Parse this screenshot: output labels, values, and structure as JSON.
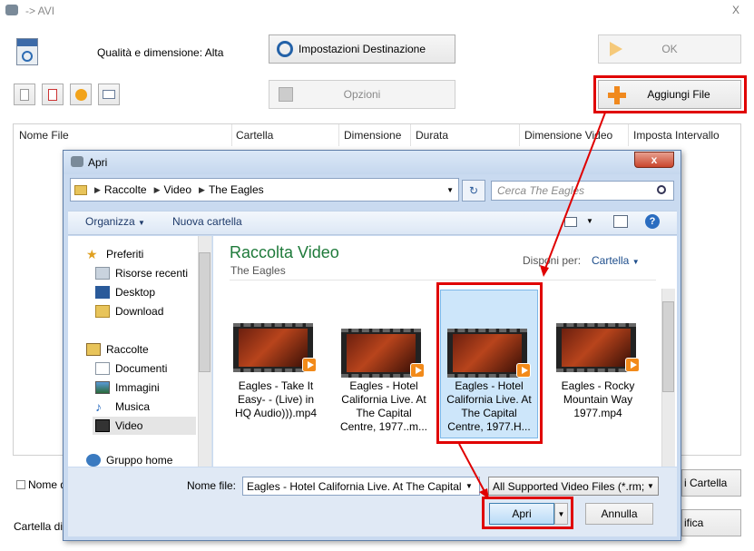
{
  "window": {
    "title": "-> AVI",
    "close_glyph": "X"
  },
  "toolbar": {
    "quality_label": "Qualità e dimensione: Alta",
    "dest_settings": "Impostazioni Destinazione",
    "options": "Opzioni",
    "ok": "OK",
    "add_file": "Aggiungi File"
  },
  "table": {
    "columns": [
      "Nome File",
      "Cartella",
      "Dimensione",
      "Durata",
      "Dimensione Video",
      "Imposta Intervallo"
    ]
  },
  "behind": {
    "name_checkbox_label": "Nome d",
    "dest_folder_label": "Cartella di D",
    "right_btn1": "i Cartella",
    "right_btn2": "ifica"
  },
  "dialog": {
    "title": "Apri",
    "breadcrumb": [
      "Raccolte",
      "Video",
      "The Eagles"
    ],
    "search_placeholder": "Cerca The Eagles",
    "organize": "Organizza",
    "new_folder": "Nuova cartella",
    "nav": {
      "favorites": "Preferiti",
      "fav_items": [
        "Risorse recenti",
        "Desktop",
        "Download"
      ],
      "libraries": "Raccolte",
      "lib_items": [
        "Documenti",
        "Immagini",
        "Musica",
        "Video"
      ],
      "homegroup": "Gruppo home"
    },
    "library_title": "Raccolta Video",
    "library_subtitle": "The Eagles",
    "arrange_label": "Disponi per:",
    "arrange_value": "Cartella",
    "files": [
      {
        "name": "Eagles -  Take It Easy- - (Live) in HQ Audio))).mp4",
        "lines": [
          "Eagles -  Take It",
          "Easy- - (Live) in",
          "HQ Audio))).mp4"
        ]
      },
      {
        "name": "Eagles - Hotel California Live. At The Capital Centre, 1977..m...",
        "lines": [
          "Eagles - Hotel",
          "California Live. At",
          "The Capital",
          "Centre, 1977..m..."
        ]
      },
      {
        "name": "Eagles - Hotel California Live. At The Capital Centre, 1977.H...",
        "lines": [
          "Eagles - Hotel",
          "California Live. At",
          "The Capital",
          "Centre, 1977.H..."
        ]
      },
      {
        "name": "Eagles - Rocky Mountain Way 1977.mp4",
        "lines": [
          "Eagles - Rocky",
          "Mountain Way",
          "1977.mp4"
        ]
      }
    ],
    "filename_label": "Nome file:",
    "filename_value": "Eagles - Hotel California Live. At The Capital",
    "filetype_value": "All Supported Video Files (*.rm;",
    "open": "Apri",
    "cancel": "Annulla"
  },
  "colors": {
    "highlight_red": "#e00000",
    "dialog_frame": "#c9daf0",
    "title_green": "#1e7a3a",
    "link_blue": "#1e4e8c"
  }
}
